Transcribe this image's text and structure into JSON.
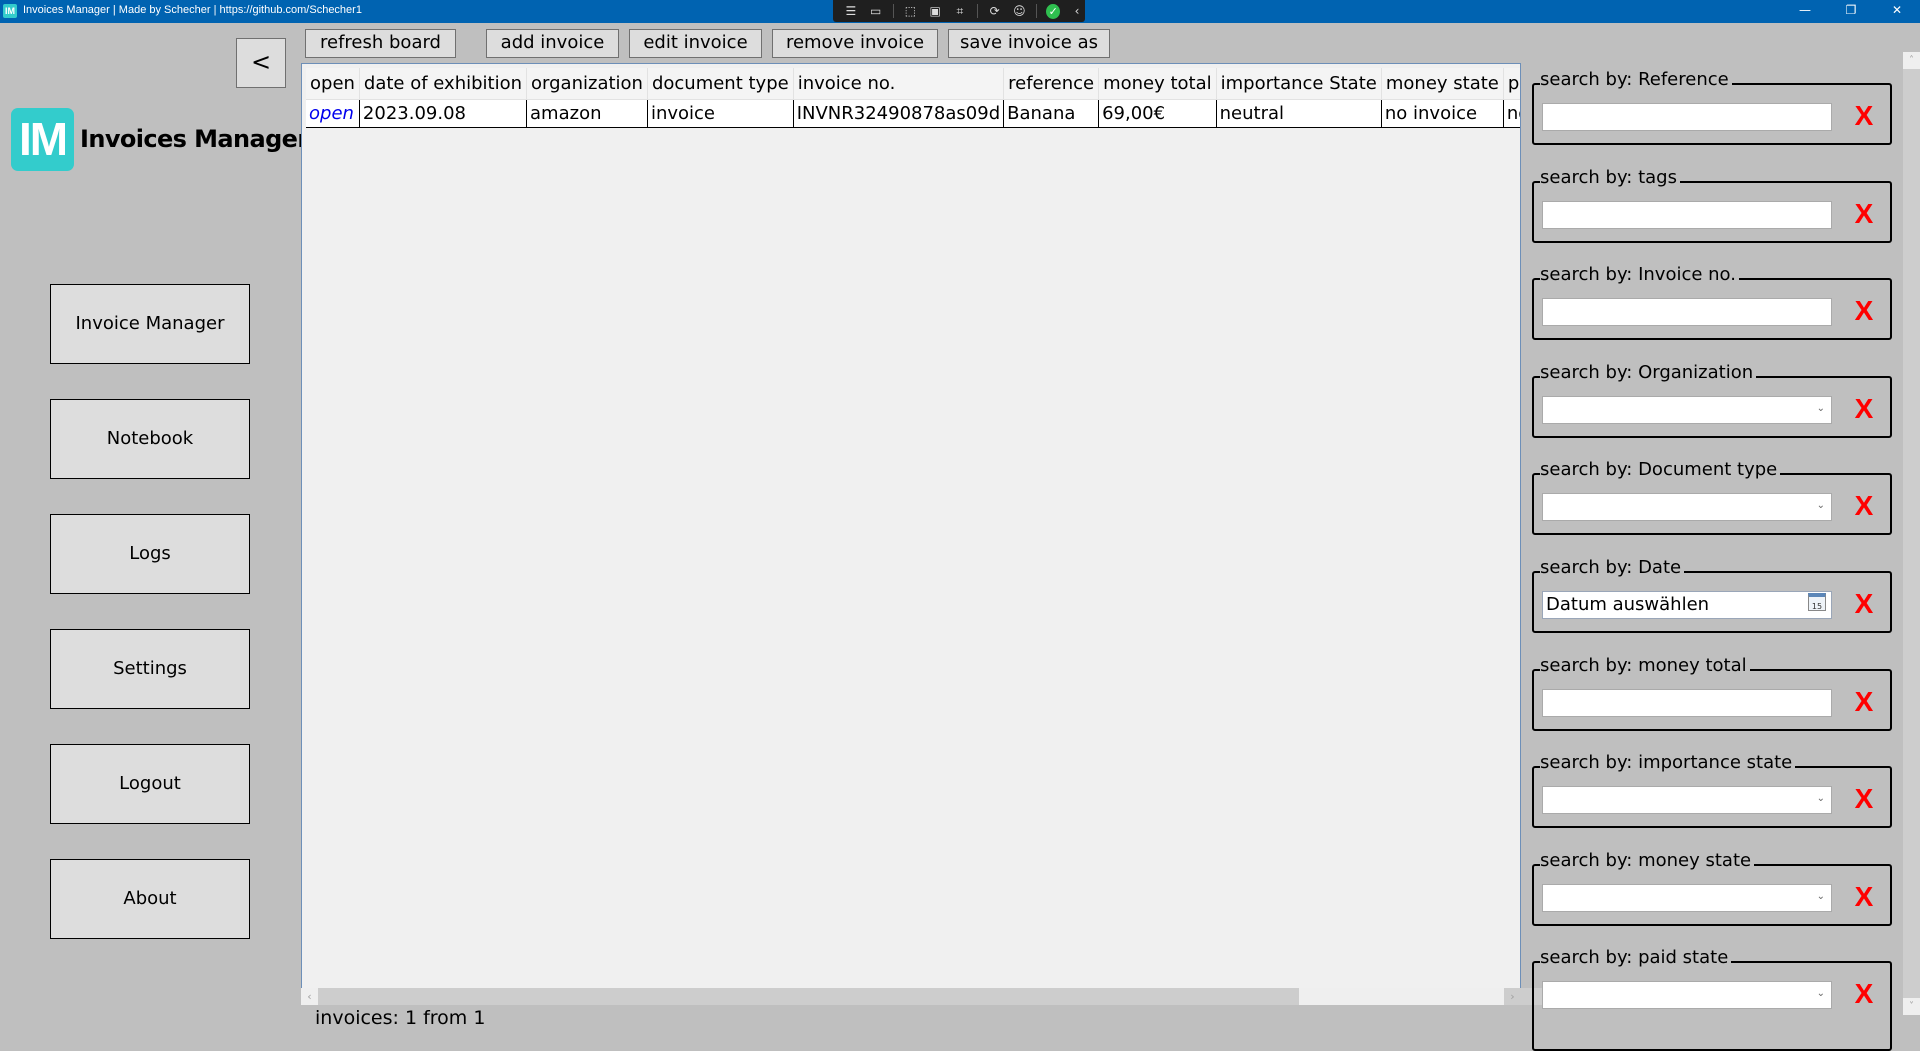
{
  "titlebar": {
    "app_icon": "IM",
    "title": "Invoices Manager | Made by Schecher | https://github.com/Schecher1",
    "dev_toolbar_icons": [
      "live-visual-tree-icon",
      "record-icon",
      "select-element-icon",
      "display-layout-adorners-icon",
      "track-focus-icon",
      "hot-reload-icon",
      "accessibility-icon",
      "binding-ok-icon",
      "collapse-icon"
    ],
    "controls": {
      "minimize": "—",
      "restore": "❐",
      "close": "✕"
    }
  },
  "sidebar": {
    "collapse_label": "<",
    "logo_text": "IM",
    "app_name": "Invoices Manager",
    "items": [
      {
        "label": "Invoice Manager"
      },
      {
        "label": "Notebook"
      },
      {
        "label": "Logs"
      },
      {
        "label": "Settings"
      },
      {
        "label": "Logout"
      },
      {
        "label": "About"
      }
    ]
  },
  "toolbar": {
    "refresh": "refresh board",
    "add": "add invoice",
    "edit": "edit invoice",
    "remove": "remove invoice",
    "save_as": "save invoice as"
  },
  "table": {
    "columns": [
      "open",
      "date of exhibition",
      "organization",
      "document type",
      "invoice no.",
      "reference",
      "money total",
      "importance State",
      "money state",
      "paid state"
    ],
    "rows": [
      [
        "open",
        "2023.09.08",
        "amazon",
        "invoice",
        "INVNR32490878as09d",
        "Banana",
        "69,00€",
        "neutral",
        "no invoice",
        "no invoice"
      ]
    ]
  },
  "status": "invoices:  1 from 1",
  "search": {
    "clear_label": "X",
    "groups": [
      {
        "label": "search by: Reference",
        "type": "text",
        "value": ""
      },
      {
        "label": "search by: tags",
        "type": "text",
        "value": ""
      },
      {
        "label": "search by: Invoice no.",
        "type": "text",
        "value": ""
      },
      {
        "label": "search by: Organization",
        "type": "select",
        "value": ""
      },
      {
        "label": "search by: Document type",
        "type": "select",
        "value": ""
      },
      {
        "label": "search by: Date",
        "type": "date",
        "placeholder": "Datum auswählen",
        "calendar_day": "15"
      },
      {
        "label": "search by: money total",
        "type": "text",
        "value": ""
      },
      {
        "label": "search by: importance state",
        "type": "select",
        "value": ""
      },
      {
        "label": "search by: money state",
        "type": "select",
        "value": ""
      },
      {
        "label": "search by: paid state",
        "type": "select",
        "value": ""
      }
    ]
  }
}
